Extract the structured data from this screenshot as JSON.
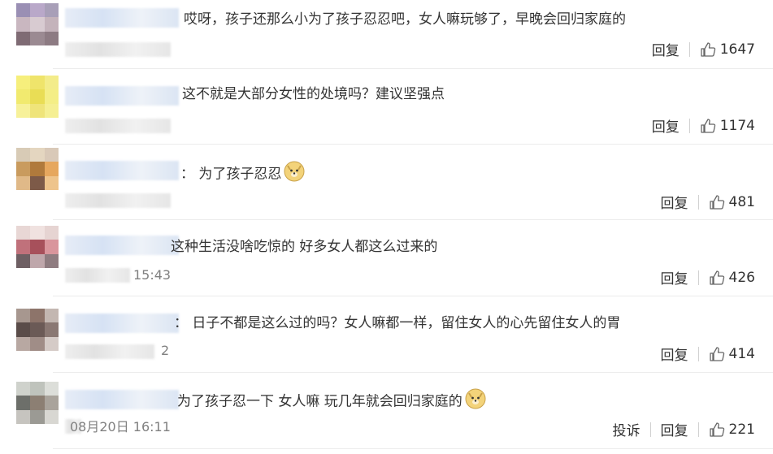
{
  "comments": [
    {
      "text": "哎呀，孩子还那么小为了孩子忍忍吧，女人嘛玩够了，早晚会回归家庭的",
      "time": "",
      "report": "",
      "reply": "回复",
      "likes": "1647",
      "emoji": false,
      "avatar": [
        "#9a8fb4",
        "#b9a8c9",
        "#a89fb8",
        "#c9b7c0",
        "#d8cbd1",
        "#c4b3bb",
        "#7f6b74",
        "#9b8a92",
        "#8d7b83"
      ]
    },
    {
      "text": "这不就是大部分女性的处境吗？建议坚强点",
      "time": "",
      "report": "",
      "reply": "回复",
      "likes": "1174",
      "emoji": false,
      "avatar": [
        "#f6ef7c",
        "#efe46b",
        "#f3ec8a",
        "#f1ea6f",
        "#e9dd55",
        "#f4ee86",
        "#f7f19a",
        "#efe47a",
        "#f5ef93"
      ]
    },
    {
      "text": "： 为了孩子忍忍",
      "time": "",
      "report": "",
      "reply": "回复",
      "likes": "481",
      "emoji": true,
      "avatar": [
        "#d8cbb6",
        "#e4d6c0",
        "#d9c9b8",
        "#c99b5e",
        "#b07a3c",
        "#e6a75e",
        "#e0b988",
        "#7d5a48",
        "#eec48c"
      ]
    },
    {
      "text": "这种生活没啥吃惊的 好多女人都这么过来的",
      "time": "15:43",
      "report": "",
      "reply": "回复",
      "likes": "426",
      "emoji": false,
      "avatar": [
        "#e8d7d5",
        "#f0e2e0",
        "#e6d4d2",
        "#c0717b",
        "#a7505b",
        "#d9959c",
        "#6e5f63",
        "#bfa7ab",
        "#8f7c80"
      ]
    },
    {
      "text": "： 日子不都是这么过的吗？女人嘛都一样，留住女人的心先留住女人的胃",
      "time": "2",
      "report": "",
      "reply": "回复",
      "likes": "414",
      "emoji": false,
      "avatar": [
        "#a7978f",
        "#8d746a",
        "#c3b7b1",
        "#5a4c49",
        "#6b5a56",
        "#8a7873",
        "#b8a8a2",
        "#a08d87",
        "#d5cbc7"
      ]
    },
    {
      "text": "为了孩子忍一下 女人嘛 玩几年就会回归家庭的",
      "time": "08月20日 16:11",
      "report": "投诉",
      "reply": "回复",
      "likes": "221",
      "emoji": true,
      "avatar": [
        "#cfd2cc",
        "#bfc3bc",
        "#dcded9",
        "#6d6f6a",
        "#8c7f73",
        "#a9a39b",
        "#c6c4bf",
        "#9b9a94",
        "#d8d7d2"
      ]
    }
  ],
  "colors": {
    "text": "#333333",
    "meta": "#808080",
    "divider": "#ececec"
  }
}
